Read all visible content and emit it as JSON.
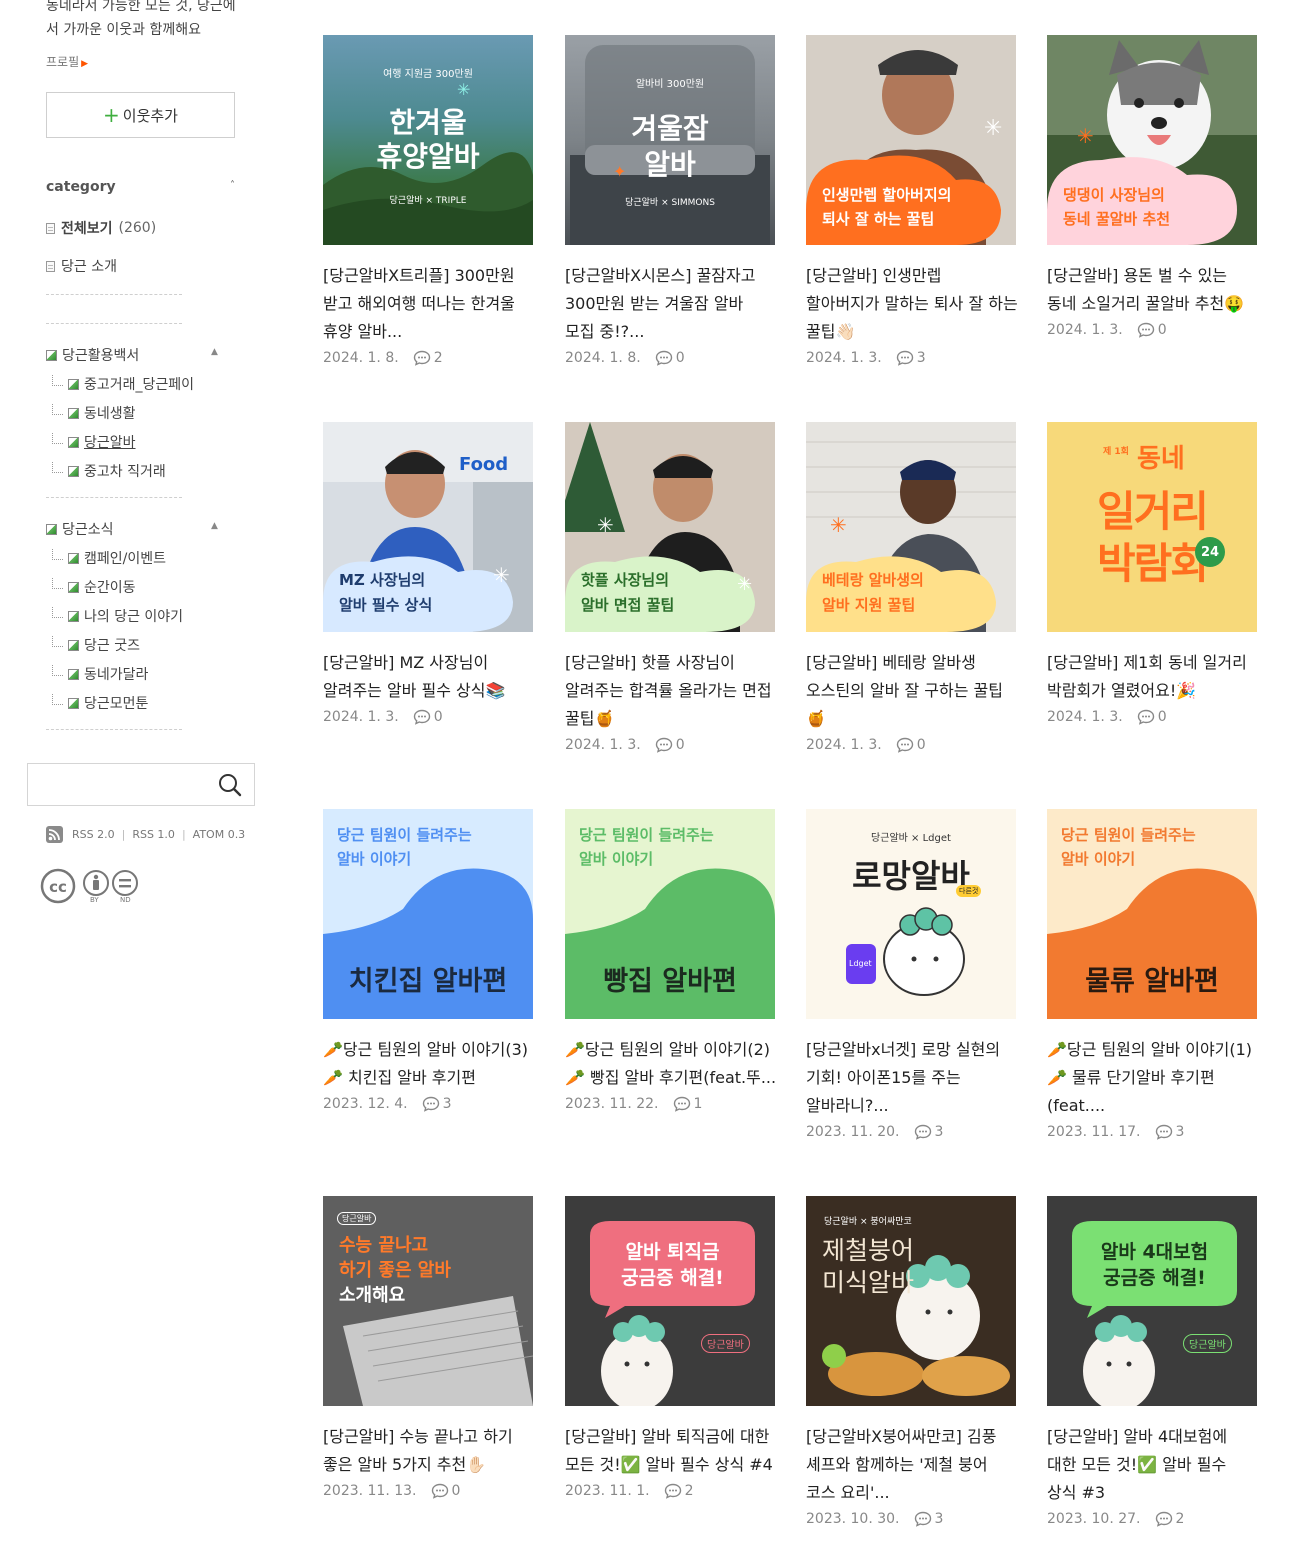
{
  "sidebar": {
    "intro": "동네라서 가능한 모든 것, 당근에서 가까운 이웃과 함께해요",
    "profile_link": "프로필",
    "add_neighbor": "이웃추가",
    "category_title": "category",
    "all_view": "전체보기",
    "all_count": "(260)",
    "intro_item": "당근 소개",
    "group1": {
      "title": "당근활용백서",
      "items": [
        "중고거래_당근페이",
        "동네생활",
        "당근알바",
        "중고차 직거래"
      ]
    },
    "group2": {
      "title": "당근소식",
      "items": [
        "캠페인/이벤트",
        "순간이동",
        "나의 당근 이야기",
        "당근 굿즈",
        "동네가달라",
        "당근모먼툰"
      ]
    },
    "search_placeholder": "",
    "feeds": [
      "RSS 2.0",
      "RSS 1.0",
      "ATOM 0.3"
    ],
    "cc_labels": [
      "BY",
      "ND"
    ]
  },
  "posts": [
    {
      "title": "[당근알바X트리플] 300만원 받고 해외여행 떠나는 한겨울 휴양 알바...",
      "date": "2024. 1. 8.",
      "comments": "2",
      "thumb": {
        "top": "여행 지원금 300만원",
        "line1": "한겨울",
        "line2": "휴양알바",
        "brand": "당근알바 × TRIPLE"
      }
    },
    {
      "title": "[당근알바X시몬스] 꿀잠자고 300만원 받는 겨울잠 알바 모집 중!?...",
      "date": "2024. 1. 8.",
      "comments": "0",
      "thumb": {
        "top": "알바비 300만원",
        "line1": "겨울잠",
        "line2": "알바",
        "brand": "당근알바 × SIMMONS"
      }
    },
    {
      "title": "[당근알바] 인생만렙 할아버지가 말하는 퇴사 잘 하는 꿀팁👋🏻",
      "date": "2024. 1. 3.",
      "comments": "3",
      "thumb": {
        "line1": "인생만렙 할아버지의",
        "line2": "퇴사 잘 하는 꿀팁"
      }
    },
    {
      "title": "[당근알바] 용돈 벌 수 있는 동네 소일거리 꿀알바 추천🤑",
      "date": "2024. 1. 3.",
      "comments": "0",
      "thumb": {
        "line1": "댕댕이 사장님의",
        "line2": "동네 꿀알바 추천"
      }
    },
    {
      "title": "[당근알바] MZ 사장님이 알려주는 알바 필수 상식📚",
      "date": "2024. 1. 3.",
      "comments": "0",
      "thumb": {
        "sign": "Food",
        "line1": "MZ 사장님의",
        "line2": "알바 필수 상식"
      }
    },
    {
      "title": "[당근알바] 핫플 사장님이 알려주는 합격률 올라가는 면접 꿀팁🍯",
      "date": "2024. 1. 3.",
      "comments": "0",
      "thumb": {
        "line1": "핫플 사장님의",
        "line2": "알바 면접 꿀팁"
      }
    },
    {
      "title": "[당근알바] 베테랑 알바생 오스틴의 알바 잘 구하는 꿀팁🍯",
      "date": "2024. 1. 3.",
      "comments": "0",
      "thumb": {
        "line1": "베테랑 알바생의",
        "line2": "알바 지원 꿀팁"
      }
    },
    {
      "title": "[당근알바] 제1회 동네 일거리 박람회가 열렸어요!🎉",
      "date": "2024. 1. 3.",
      "comments": "0",
      "thumb": {
        "small": "제 1회",
        "line0": "동네",
        "line1": "일거리",
        "line2": "박람회",
        "badge": "24"
      }
    },
    {
      "title": "🥕당근 팀원의 알바 이야기(3)🥕 치킨집 알바 후기편",
      "date": "2023. 12. 4.",
      "comments": "3",
      "thumb": {
        "line1": "당근 팀원이 들려주는",
        "line2": "알바 이야기",
        "big": "치킨집 알바편"
      }
    },
    {
      "title": "🥕당근 팀원의 알바 이야기(2)🥕 빵집 알바 후기편(feat.뚜...",
      "date": "2023. 11. 22.",
      "comments": "1",
      "thumb": {
        "line1": "당근 팀원이 들려주는",
        "line2": "알바 이야기",
        "big": "빵집 알바편"
      }
    },
    {
      "title": "[당근알바x너겟] 로망 실현의 기회! 아이폰15를 주는 알바라니?...",
      "date": "2023. 11. 20.",
      "comments": "3",
      "thumb": {
        "brand": "당근알바 × Ldget",
        "line1": "로망알바",
        "tag": "다른것",
        "phone": "Ldget"
      }
    },
    {
      "title": "🥕당근 팀원의 알바 이야기(1)🥕 물류 단기알바 후기편(feat....",
      "date": "2023. 11. 17.",
      "comments": "3",
      "thumb": {
        "line1": "당근 팀원이 들려주는",
        "line2": "알바 이야기",
        "big": "물류 알바편"
      }
    },
    {
      "title": "[당근알바] 수능 끝나고 하기 좋은 알바 5가지 추천✋🏻",
      "date": "2023. 11. 13.",
      "comments": "0",
      "thumb": {
        "tag": "당근알바",
        "line1": "수능 끝나고",
        "line2": "하기 좋은 알바",
        "line3": "소개해요"
      }
    },
    {
      "title": "[당근알바] 알바 퇴직금에 대한 모든 것!✅ 알바 필수 상식 #4",
      "date": "2023. 11. 1.",
      "comments": "2",
      "thumb": {
        "line1": "알바 퇴직금",
        "line2": "궁금증 해결!",
        "tag": "당근알바"
      }
    },
    {
      "title": "[당근알바X붕어싸만코] 김풍 셰프와 함께하는 '제철 붕어 코스 요리'...",
      "date": "2023. 10. 30.",
      "comments": "3",
      "thumb": {
        "brand": "당근알바 × 붕어싸만코",
        "line1": "제철붕어",
        "line2": "미식알바"
      }
    },
    {
      "title": "[당근알바] 알바 4대보험에 대한 모든 것!✅ 알바 필수 상식 #3",
      "date": "2023. 10. 27.",
      "comments": "2",
      "thumb": {
        "line1": "알바 4대보험",
        "line2": "궁금증 해결!",
        "tag": "당근알바"
      }
    }
  ],
  "colors": {
    "accent": "#ff6f0f",
    "green": "#3fae3f"
  }
}
